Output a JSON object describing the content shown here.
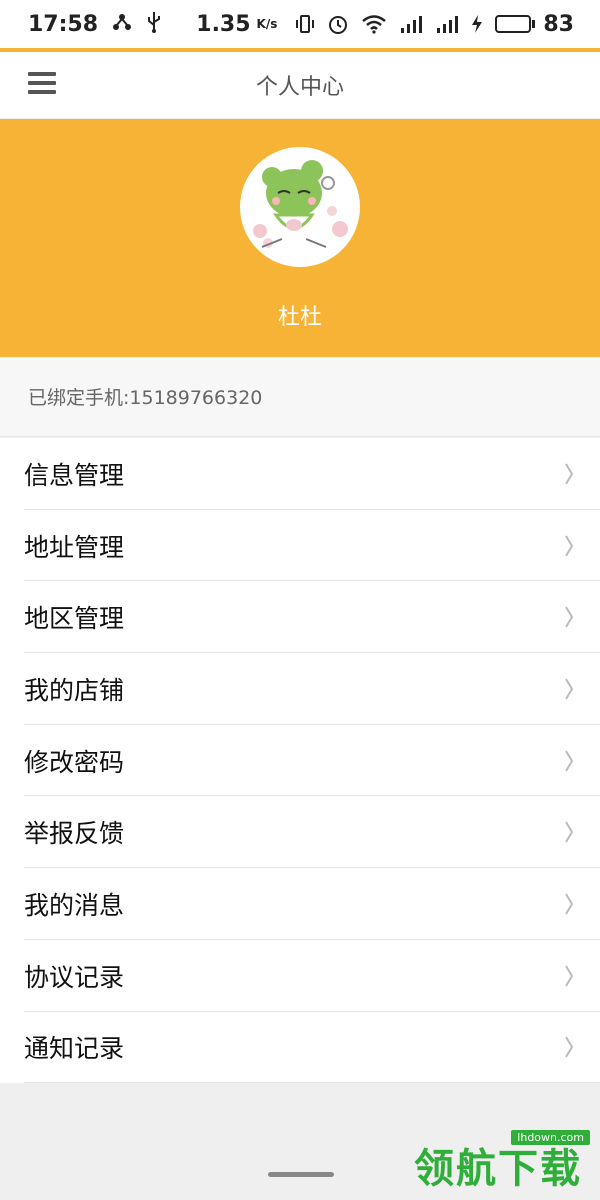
{
  "status_bar": {
    "time": "17:58",
    "net_speed": "1.35",
    "net_speed_unit": "K/s",
    "battery_percent": "83",
    "battery_level": 0.83,
    "icons": [
      "usb-share-icon",
      "usb-icon",
      "vibrate-icon",
      "alarm-icon",
      "wifi-icon",
      "signal-4g-icon",
      "signal-4g-icon",
      "charging-icon",
      "battery-icon"
    ]
  },
  "header": {
    "title": "个人中心",
    "menu_icon": "hamburger-menu-icon"
  },
  "profile": {
    "username": "杜杜",
    "phone_label": "已绑定手机:15189766320"
  },
  "menu": {
    "items": [
      {
        "label": "信息管理"
      },
      {
        "label": "地址管理"
      },
      {
        "label": "地区管理"
      },
      {
        "label": "我的店铺"
      },
      {
        "label": "修改密码"
      },
      {
        "label": "举报反馈"
      },
      {
        "label": "我的消息"
      },
      {
        "label": "协议记录"
      },
      {
        "label": "通知记录"
      }
    ]
  },
  "watermark": {
    "brand": "领航下载",
    "domain": "lhdown.com"
  },
  "colors": {
    "accent": "#f6b336",
    "watermark": "#2fae3a"
  }
}
